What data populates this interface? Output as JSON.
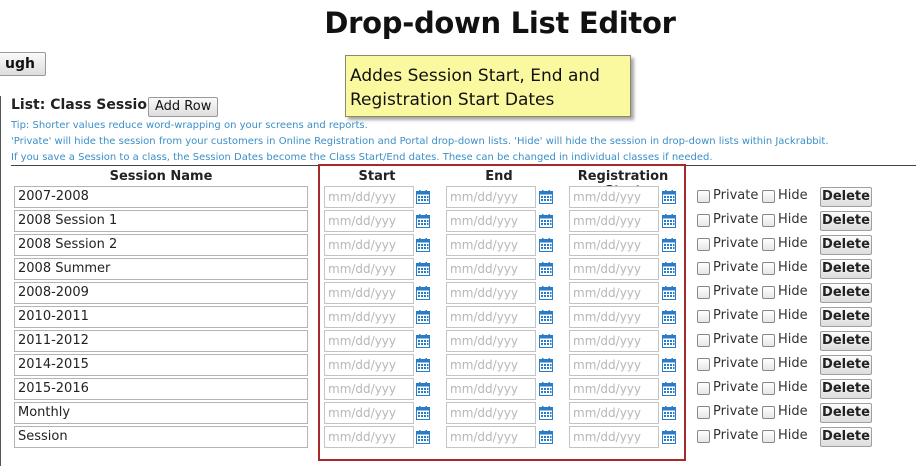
{
  "page": {
    "title": "Drop-down List Editor"
  },
  "walkthrough_button_label": "ugh",
  "callout": {
    "line1": "Addes Session Start, End and",
    "line2": "Registration Start Dates"
  },
  "list": {
    "title": "List: Class Session",
    "add_row_label": "Add Row",
    "tips": [
      "Tip: Shorter values reduce word-wrapping on your screens and reports.",
      "'Private' will hide the session from your customers in Online Registration and Portal drop-down lists. 'Hide' will hide the session in drop-down lists within Jackrabbit.",
      "If you save a Session to a class, the Session Dates become the Class Start/End dates. These can be changed in individual classes if needed."
    ],
    "columns": {
      "name": "Session Name",
      "start": "Start",
      "end": "End",
      "reg_start": "Registration Start"
    },
    "date_placeholder": "mm/dd/yyy",
    "private_label": "Private",
    "hide_label": "Hide",
    "delete_label": "Delete",
    "rows": [
      {
        "name": "2007-2008"
      },
      {
        "name": "2008 Session 1"
      },
      {
        "name": "2008 Session 2"
      },
      {
        "name": "2008 Summer"
      },
      {
        "name": "2008-2009"
      },
      {
        "name": "2010-2011"
      },
      {
        "name": "2011-2012"
      },
      {
        "name": "2014-2015"
      },
      {
        "name": "2015-2016"
      },
      {
        "name": "Monthly"
      },
      {
        "name": "Session"
      }
    ]
  },
  "colors": {
    "tip_text": "#3b8fc9",
    "callout_bg": "#fbf9a0",
    "highlight_border": "#a52a2a",
    "calendar_icon": "#2a7cc7"
  }
}
